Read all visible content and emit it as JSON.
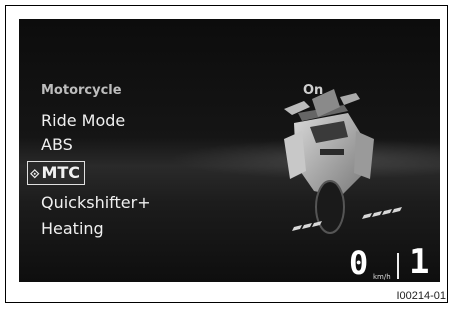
{
  "screen": {
    "menu": {
      "header": "Motorcycle",
      "header_value": "On",
      "items": [
        {
          "label": "Ride Mode"
        },
        {
          "label": "ABS"
        },
        {
          "label": "MTC",
          "selected": true
        },
        {
          "label": "Quickshifter+"
        },
        {
          "label": "Heating"
        }
      ]
    },
    "speed": {
      "value": "0",
      "unit": "km/h"
    },
    "gear": "1",
    "illustration": "motorcycle-rear-icon"
  },
  "figure_code": "I00214-01",
  "colors": {
    "background": "#0c0c0c",
    "text": "#f0f0f0",
    "dim_text": "#bdbdbd"
  }
}
